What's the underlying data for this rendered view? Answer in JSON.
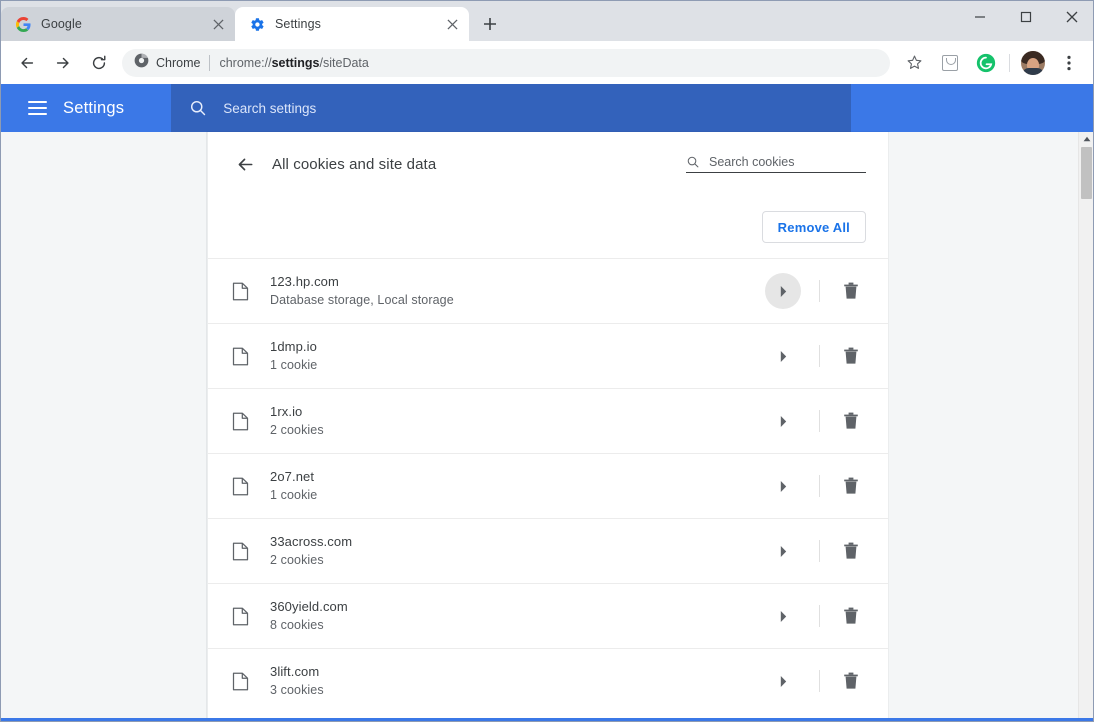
{
  "browser": {
    "tabs": [
      {
        "title": "Google",
        "favicon": "google-logo-icon",
        "active": false,
        "close_label": "×"
      },
      {
        "title": "Settings",
        "favicon": "gear-icon",
        "active": true,
        "close_label": "×"
      }
    ],
    "new_tab_label": "+",
    "window_controls": {
      "minimize": "—",
      "maximize": "☐",
      "close": "✕"
    },
    "toolbar": {
      "back_label": "back-arrow-icon",
      "forward_label": "forward-arrow-icon",
      "reload_label": "reload-icon",
      "omnibox": {
        "chip_label": "Chrome",
        "url_prefix": "chrome://",
        "url_bold": "settings",
        "url_suffix": "/siteData"
      },
      "bookmark_label": "star-icon",
      "extension_label": "extension-icon",
      "grammarly_label": "G",
      "avatar_label": "profile-avatar",
      "menu_label": "three-dot-menu-icon"
    }
  },
  "settings_header": {
    "menu_label": "hamburger-menu-icon",
    "title": "Settings",
    "search": {
      "placeholder": "Search settings",
      "value": ""
    }
  },
  "page": {
    "title": "All cookies and site data",
    "back_label": "back-arrow-icon",
    "cookie_search": {
      "placeholder": "Search cookies",
      "value": ""
    },
    "remove_all_label": "Remove All",
    "rows": [
      {
        "site": "123.hp.com",
        "detail": "Database storage, Local storage",
        "hovered": true
      },
      {
        "site": "1dmp.io",
        "detail": "1 cookie",
        "hovered": false
      },
      {
        "site": "1rx.io",
        "detail": "2 cookies",
        "hovered": false
      },
      {
        "site": "2o7.net",
        "detail": "1 cookie",
        "hovered": false
      },
      {
        "site": "33across.com",
        "detail": "2 cookies",
        "hovered": false
      },
      {
        "site": "360yield.com",
        "detail": "8 cookies",
        "hovered": false
      },
      {
        "site": "3lift.com",
        "detail": "3 cookies",
        "hovered": false
      }
    ]
  },
  "colors": {
    "settings_header_blue": "#3b78e7",
    "settings_search_blue": "#3362bb",
    "accent_blue": "#1a73e8",
    "text_primary": "#3c4043",
    "text_secondary": "#5f6368",
    "tab_strip_bg": "#dee1e6",
    "inactive_tab_bg": "#cfd3d9"
  }
}
